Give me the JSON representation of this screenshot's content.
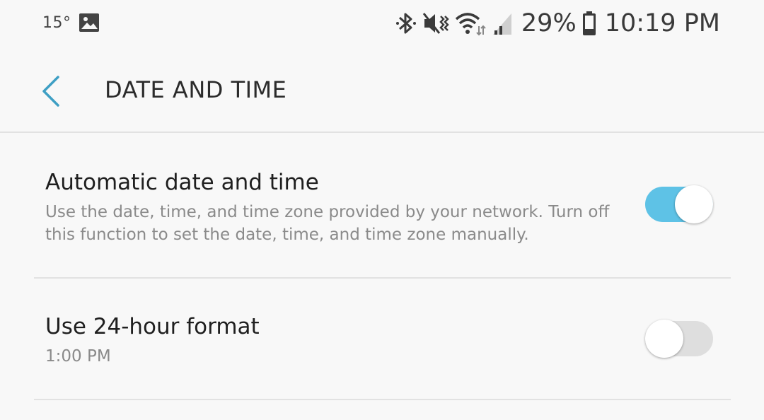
{
  "status_bar": {
    "temperature": "15°",
    "battery_percent": "29%",
    "clock": "10:19 PM",
    "icons": [
      "image-icon",
      "bluetooth-icon",
      "mute-vibrate-icon",
      "wifi-icon",
      "cell-signal-icon",
      "battery-icon"
    ]
  },
  "header": {
    "title": "DATE AND TIME",
    "back_icon": "chevron-left-icon",
    "accent_color": "#3e9fc4"
  },
  "settings": [
    {
      "title": "Automatic date and time",
      "description": "Use the date, time, and time zone provided by your network. Turn off this function to set the date, time, and time zone manually.",
      "enabled": true
    },
    {
      "title": "Use 24-hour format",
      "description": "1:00 PM",
      "enabled": false
    }
  ],
  "colors": {
    "toggle_on": "#5ec2e6",
    "toggle_off": "#dedede",
    "background": "#f8f8f8"
  }
}
